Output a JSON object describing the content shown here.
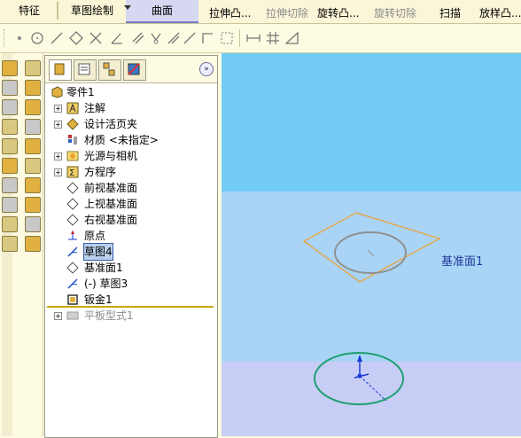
{
  "toolbar": {
    "tabs": [
      {
        "label": "特征",
        "active": false
      },
      {
        "label": "草图绘制",
        "active": true
      },
      {
        "label": "曲面",
        "active": true
      }
    ],
    "buttons": [
      {
        "label": "拉伸凸...",
        "enabled": true
      },
      {
        "label": "拉伸切除",
        "enabled": false
      },
      {
        "label": "旋转凸...",
        "enabled": true
      },
      {
        "label": "旋转切除",
        "enabled": false
      },
      {
        "label": "扫描",
        "enabled": true
      },
      {
        "label": "放样凸...",
        "enabled": true
      }
    ]
  },
  "feature_manager": {
    "expand_glyph": "»",
    "root": "零件1",
    "items": [
      {
        "label": "注解",
        "icon": "annotation-icon",
        "expandable": true
      },
      {
        "label": "设计活页夹",
        "icon": "design-binder-icon",
        "expandable": true
      },
      {
        "label": "材质 <未指定>",
        "icon": "material-icon",
        "expandable": false
      },
      {
        "label": "光源与相机",
        "icon": "lights-cameras-icon",
        "expandable": true
      },
      {
        "label": "方程序",
        "icon": "equations-icon",
        "expandable": true
      },
      {
        "label": "前视基准面",
        "icon": "plane-icon",
        "expandable": false
      },
      {
        "label": "上视基准面",
        "icon": "plane-icon",
        "expandable": false
      },
      {
        "label": "右视基准面",
        "icon": "plane-icon",
        "expandable": false
      },
      {
        "label": "原点",
        "icon": "origin-icon",
        "expandable": false
      },
      {
        "label": "草图4",
        "icon": "sketch-icon",
        "expandable": false,
        "selected": true
      },
      {
        "label": "基准面1",
        "icon": "plane-icon",
        "expandable": false
      },
      {
        "label": "(-) 草图3",
        "icon": "sketch-icon",
        "expandable": false
      },
      {
        "label": "钣金1",
        "icon": "sheet-metal-icon",
        "expandable": false
      },
      {
        "label": "平板型式1",
        "icon": "flat-pattern-icon",
        "expandable": true,
        "suppressed": true
      }
    ]
  },
  "graphics": {
    "plane_label": "基准面1",
    "colors": {
      "background_top": "#72cbf5",
      "background_mid": "#a9d4f6",
      "background_bottom": "#c7cdf5",
      "plane_outline": "#f0a030",
      "circle_gray": "#909090",
      "circle_green": "#1ea070",
      "label": "#1e3a9a"
    }
  }
}
